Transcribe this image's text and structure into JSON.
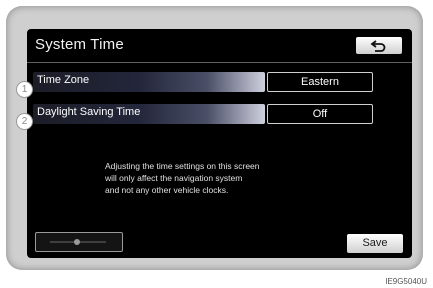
{
  "screen": {
    "title": "System Time",
    "back_icon": "u-turn-back-icon"
  },
  "settings": [
    {
      "number": "1",
      "label": "Time Zone",
      "value": "Eastern"
    },
    {
      "number": "2",
      "label": "Daylight Saving Time",
      "value": "Off"
    }
  ],
  "info": {
    "line1": "Adjusting the time settings on this screen",
    "line2": "will only affect the navigation system",
    "line3": "and not any other vehicle clocks."
  },
  "save_label": "Save",
  "figure_code": "IE9G5040U",
  "colors": {
    "screen_bg": "#000000",
    "button_bg": "#eeeeee",
    "row_highlight": "#3a3d52"
  }
}
